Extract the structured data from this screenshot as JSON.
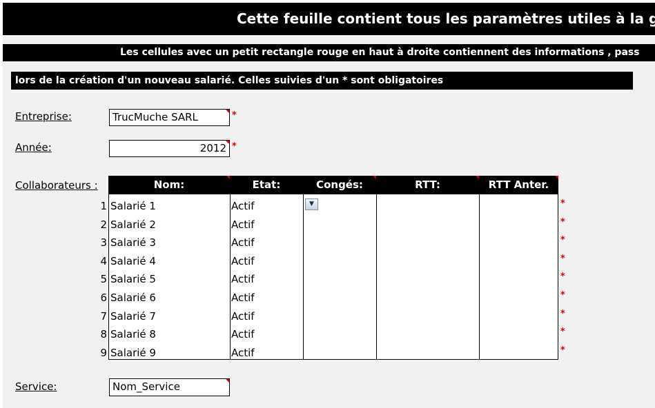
{
  "header": {
    "title": "Cette feuille contient tous les paramètres utiles à la g",
    "notice_line1": "Les cellules avec un petit rectangle rouge en haut à droite contiennent des informations , pass",
    "notice_line2": "lors de la création d'un nouveau salarié. Celles suivies d'un * sont obligatoires"
  },
  "fields": {
    "entreprise_label": "Entreprise:",
    "entreprise_value": "TrucMuche SARL",
    "annee_label": "Année:",
    "annee_value": "2012",
    "collaborateurs_label": "Collaborateurs :",
    "service_label": "Service:",
    "service_value": "Nom_Service",
    "required_mark": "*"
  },
  "table": {
    "columns": [
      "Nom:",
      "Etat:",
      "Congés:",
      "RTT:",
      "RTT Anter."
    ],
    "rows": [
      {
        "num": "1",
        "name": "Salarié 1",
        "state": "Actif"
      },
      {
        "num": "2",
        "name": "Salarié 2",
        "state": "Actif"
      },
      {
        "num": "3",
        "name": "Salarié 3",
        "state": "Actif"
      },
      {
        "num": "4",
        "name": "Salarié 4",
        "state": "Actif"
      },
      {
        "num": "5",
        "name": "Salarié 5",
        "state": "Actif"
      },
      {
        "num": "6",
        "name": "Salarié 6",
        "state": "Actif"
      },
      {
        "num": "7",
        "name": "Salarié 7",
        "state": "Actif"
      },
      {
        "num": "8",
        "name": "Salarié 8",
        "state": "Actif"
      },
      {
        "num": "9",
        "name": "Salarié 9",
        "state": "Actif"
      }
    ],
    "dropdown_icon": "chevron-down-icon"
  },
  "colors": {
    "header_bg": "#000000",
    "required_red": "#e00000",
    "sheet_bg": "#f1f1f1"
  }
}
